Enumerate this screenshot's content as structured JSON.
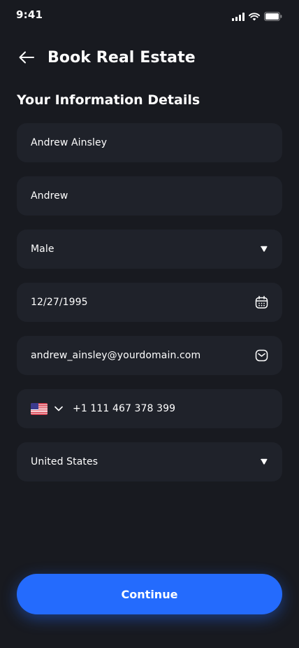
{
  "status_bar": {
    "time": "9:41",
    "icons": [
      "cellular-signal-icon",
      "wifi-icon",
      "battery-icon"
    ]
  },
  "header": {
    "title": "Book Real Estate",
    "back_icon": "arrow-left-icon"
  },
  "form": {
    "section_title": "Your Information Details",
    "full_name": "Andrew Ainsley",
    "nickname": "Andrew",
    "gender": "Male",
    "date_of_birth": "12/27/1995",
    "email": "andrew_ainsley@yourdomain.com",
    "phone_country_flag": "us-flag-icon",
    "phone": "+1 111 467 378 399",
    "country": "United States"
  },
  "actions": {
    "continue_label": "Continue"
  },
  "colors": {
    "background": "#181a20",
    "field_background": "#1f222a",
    "primary": "#246bfd",
    "text": "#ffffff"
  }
}
